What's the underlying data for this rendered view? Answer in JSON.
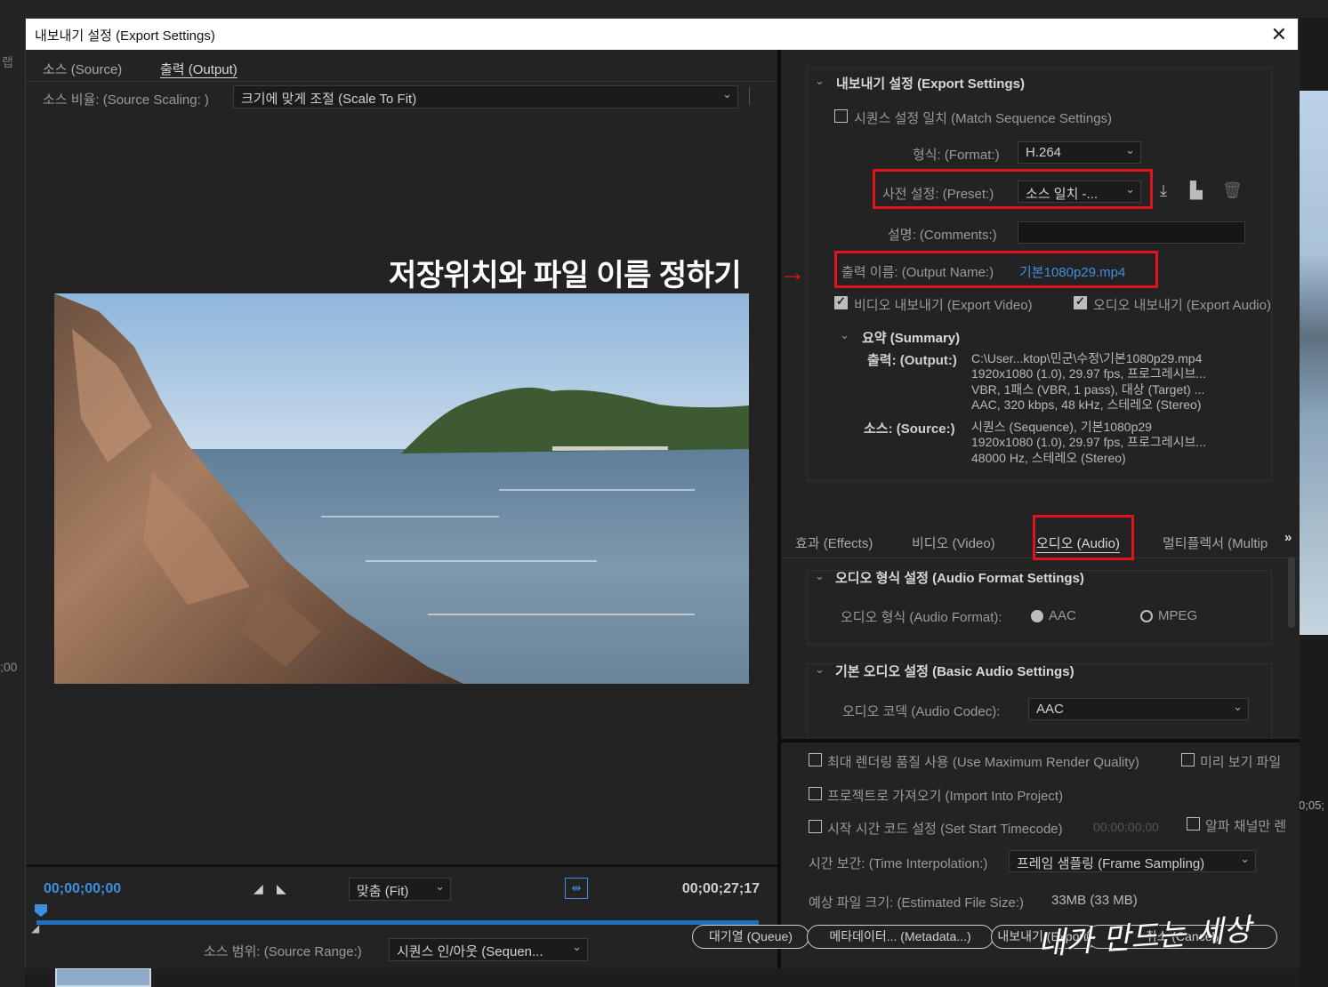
{
  "background": {
    "left_label_top": "랩",
    "left_timecode": ";00",
    "right_timecode": "0;05;"
  },
  "dialog": {
    "title": "내보내기 설정 (Export Settings)",
    "close_glyph": "✕"
  },
  "left_tabs": [
    {
      "label": "소스 (Source)",
      "active": false
    },
    {
      "label": "출력 (Output)",
      "active": true
    }
  ],
  "source_scaling": {
    "label": "소스 비율: (Source Scaling: )",
    "value": "크기에 맞게 조절 (Scale To Fit)"
  },
  "timeline": {
    "timecode_start": "00;00;00;00",
    "timecode_end": "00;00;27;17",
    "zoom_select": "맞춤 (Fit)",
    "source_range_label": "소스 범위: (Source Range:)",
    "source_range_value": "시퀀스 인/아웃 (Sequen..."
  },
  "export_settings": {
    "header": "내보내기 설정 (Export Settings)",
    "match_sequence": {
      "label": "시퀀스 설정 일치 (Match Sequence Settings)",
      "checked": false
    },
    "format": {
      "label": "형식: (Format:)",
      "value": "H.264"
    },
    "preset": {
      "label": "사전 설정: (Preset:)",
      "value": "소스 일치 -..."
    },
    "comments": {
      "label": "설명: (Comments:)",
      "value": ""
    },
    "output_name": {
      "label": "출력 이름: (Output Name:)",
      "value": "기본1080p29.mp4"
    },
    "export_video": {
      "label": "비디오 내보내기 (Export Video)",
      "checked": true
    },
    "export_audio": {
      "label": "오디오 내보내기 (Export Audio)",
      "checked": true
    },
    "icons": [
      "save-preset-icon",
      "import-preset-icon",
      "delete-preset-icon"
    ]
  },
  "summary": {
    "header": "요약 (Summary)",
    "output_key": "출력: (Output:)",
    "output_lines": [
      "C:\\User...ktop\\민군\\수정\\기본1080p29.mp4",
      "1920x1080 (1.0), 29.97 fps, 프로그레시브...",
      "VBR, 1패스 (VBR, 1 pass), 대상 (Target) ...",
      "AAC, 320 kbps, 48 kHz, 스테레오 (Stereo)"
    ],
    "source_key": "소스: (Source:)",
    "source_lines": [
      "시퀀스 (Sequence), 기본1080p29",
      "1920x1080 (1.0), 29.97 fps, 프로그레시브...",
      "48000 Hz, 스테레오 (Stereo)"
    ]
  },
  "right_tabs": [
    {
      "label": "효과 (Effects)",
      "active": false
    },
    {
      "label": "비디오 (Video)",
      "active": false
    },
    {
      "label": "오디오 (Audio)",
      "active": true
    },
    {
      "label": "멀티플렉서 (Multip",
      "active": false
    }
  ],
  "right_tabs_more": "»",
  "audio_format_settings": {
    "header": "오디오 형식 설정 (Audio Format Settings)",
    "format_label": "오디오 형식 (Audio Format):",
    "options": [
      {
        "label": "AAC",
        "selected": true
      },
      {
        "label": "MPEG",
        "selected": false
      }
    ]
  },
  "basic_audio_settings": {
    "header": "기본 오디오 설정 (Basic Audio Settings)",
    "codec_label": "오디오 코덱 (Audio Codec):",
    "codec_value": "AAC"
  },
  "bottom_options": {
    "max_render": {
      "label": "최대 렌더링 품질 사용 (Use Maximum Render Quality)",
      "checked": false
    },
    "preview_file": {
      "label": "미리 보기 파일",
      "checked": false
    },
    "import_project": {
      "label": "프로젝트로 가져오기 (Import Into Project)",
      "checked": false
    },
    "start_timecode": {
      "label": "시작 시간 코드 설정 (Set Start Timecode)",
      "checked": false,
      "value": "00;00;00;00"
    },
    "alpha_only": {
      "label": "알파 채널만 렌",
      "checked": false
    },
    "time_interp": {
      "label": "시간 보간: (Time Interpolation:)",
      "value": "프레임 샘플링 (Frame Sampling)"
    },
    "est_size": {
      "label": "예상 파일 크기: (Estimated File Size:)",
      "value": "33MB (33 MB)"
    }
  },
  "buttons": {
    "queue": "대기열 (Queue)",
    "metadata": "메타데이터... (Metadata...)",
    "export": "내보내기 (Export)",
    "cancel": "취소 (Cancel)"
  },
  "annotations": {
    "callout_text": "저장위치와 파일 이름 정하기",
    "callout_arrow": "→",
    "watermark": "내가 만드는 세상",
    "highlight_color": "#e0141a"
  },
  "colors": {
    "accent_blue": "#3f8fe0",
    "panel_bg": "#232323"
  }
}
